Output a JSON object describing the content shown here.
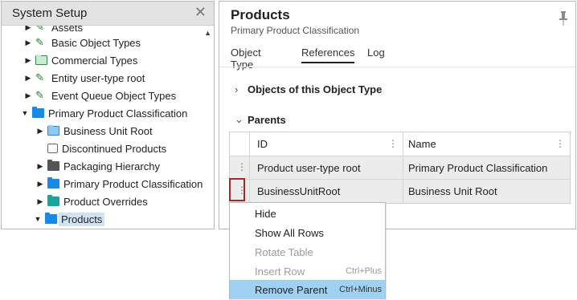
{
  "left_panel": {
    "title": "System Setup",
    "close_glyph": "✕",
    "tree": [
      {
        "label": "Assets",
        "icon": "pencil-icon",
        "expanded": false
      },
      {
        "label": "Basic Object Types",
        "icon": "pencil-icon",
        "expanded": false
      },
      {
        "label": "Commercial Types",
        "icon": "folder-light-green-icon",
        "expanded": false
      },
      {
        "label": "Entity user-type root",
        "icon": "pencil-icon",
        "expanded": false
      },
      {
        "label": "Event Queue Object Types",
        "icon": "pencil-icon",
        "expanded": false
      },
      {
        "label": "Primary Product Classification",
        "icon": "folder-blue-icon",
        "expanded": true
      },
      {
        "label": "Business Unit Root",
        "icon": "folder-light-blue-icon",
        "expanded": false
      },
      {
        "label": "Discontinued Products",
        "icon": "cube-icon",
        "expanded": null
      },
      {
        "label": "Packaging Hierarchy",
        "icon": "folder-dark-icon",
        "expanded": false
      },
      {
        "label": "Primary Product Classification",
        "icon": "folder-blue-icon",
        "expanded": false
      },
      {
        "label": "Product Overrides",
        "icon": "folder-teal-icon",
        "expanded": false
      },
      {
        "label": "Products",
        "icon": "folder-blue-icon",
        "expanded": true,
        "selected": true
      }
    ]
  },
  "right_panel": {
    "title": "Products",
    "subtitle": "Primary Product Classification",
    "tabs": [
      "Object Type",
      "References",
      "Log"
    ],
    "active_tab": "References",
    "sections": {
      "objects": "Objects of this Object Type",
      "parents": "Parents"
    },
    "grid": {
      "columns": [
        "ID",
        "Name"
      ],
      "rows": [
        {
          "id": "Product user-type root",
          "name": "Primary Product Classification"
        },
        {
          "id": "BusinessUnitRoot",
          "name": "Business Unit Root"
        }
      ]
    }
  },
  "context_menu": {
    "items": [
      {
        "label": "Hide",
        "shortcut": "",
        "disabled": false,
        "hovered": false
      },
      {
        "label": "Show All Rows",
        "shortcut": "",
        "disabled": false,
        "hovered": false
      },
      {
        "label": "Rotate Table",
        "shortcut": "",
        "disabled": true,
        "hovered": false
      },
      {
        "label": "Insert Row",
        "shortcut": "Ctrl+Plus",
        "disabled": true,
        "hovered": false
      },
      {
        "label": "Remove Parent",
        "shortcut": "Ctrl+Minus",
        "disabled": false,
        "hovered": true
      }
    ]
  },
  "colors": {
    "folder_blue": "#1a88e6",
    "folder_teal": "#1ba49b",
    "menu_hover": "#9fd1f3",
    "highlight_border": "#a32a2a",
    "tree_selection": "#cfe3f4"
  }
}
